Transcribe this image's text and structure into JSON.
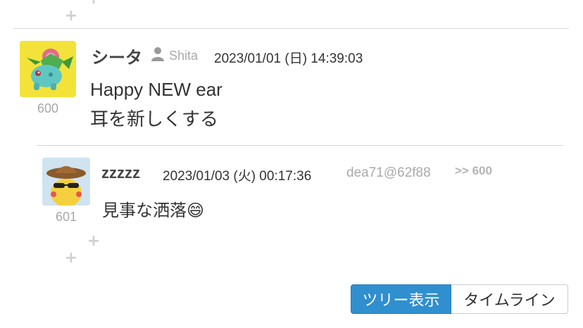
{
  "post600": {
    "name": "シータ",
    "user_id": "Shita",
    "datetime": "2023/01/01 (日) 14:39:03",
    "number": "600",
    "line1": "Happy NEW ear",
    "line2": "耳を新しくする",
    "avatar_icon": "ivysaur-icon"
  },
  "post601": {
    "name": "zzzzz",
    "datetime": "2023/01/03 (火) 00:17:36",
    "user_id": "dea71@62f88",
    "reply_to": ">> 600",
    "number": "601",
    "line1": "見事な洒落",
    "emoji": "😄",
    "avatar_icon": "pikachu-icon"
  },
  "plus_symbol": "+",
  "view_toggle": {
    "tree_label": "ツリー表示",
    "timeline_label": "タイムライン",
    "selected": "tree"
  },
  "colors": {
    "accent": "#2f8fcf",
    "muted": "#aaaaaa"
  }
}
